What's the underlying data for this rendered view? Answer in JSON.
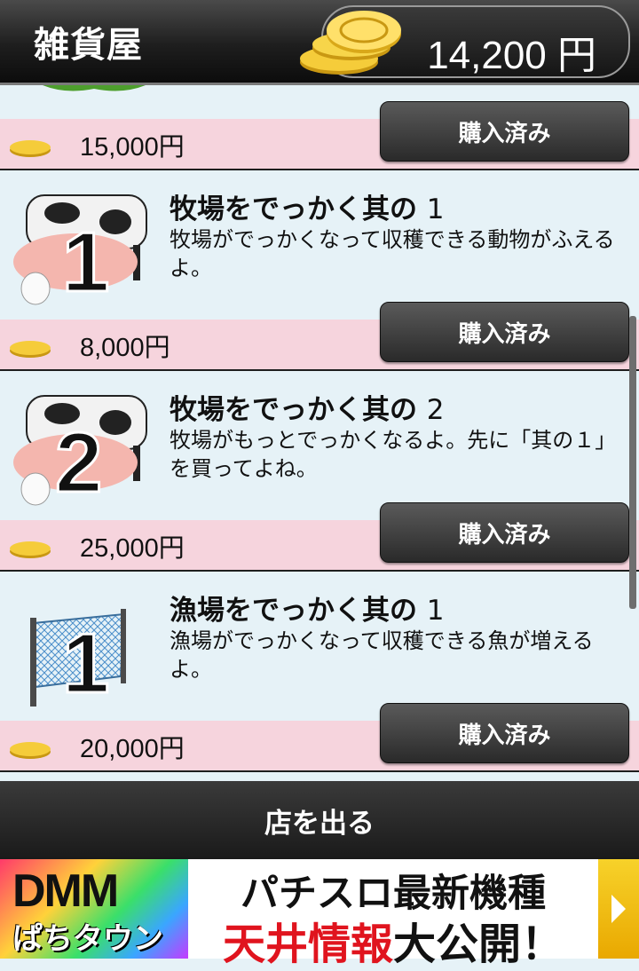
{
  "header": {
    "title": "雑貨屋",
    "money": "14,200 円"
  },
  "top_item": {
    "price": "15,000円",
    "button": "購入済み"
  },
  "items": [
    {
      "title": "牧場をでっかく其の",
      "number": "1",
      "desc": "牧場がでっかくなって収穫できる動物がふえるよ。",
      "price": "8,000円",
      "button": "購入済み",
      "image": "farm-animals-1"
    },
    {
      "title": "牧場をでっかく其の",
      "number": "2",
      "desc": "牧場がもっとでっかくなるよ。先に「其の１」を買ってよね。",
      "price": "25,000円",
      "button": "購入済み",
      "image": "farm-animals-2"
    },
    {
      "title": "漁場をでっかく其の",
      "number": "1",
      "desc": "漁場がでっかくなって収穫できる魚が増えるよ。",
      "price": "20,000円",
      "button": "購入済み",
      "image": "fishing-net-1"
    }
  ],
  "footer": {
    "leave_label": "店を出る"
  },
  "ad": {
    "logo": "DMM",
    "logo_sub": "ぱちタウン",
    "line1": "パチスロ最新機種",
    "line2_red": "天井情報",
    "line2_black": "大公開！"
  }
}
